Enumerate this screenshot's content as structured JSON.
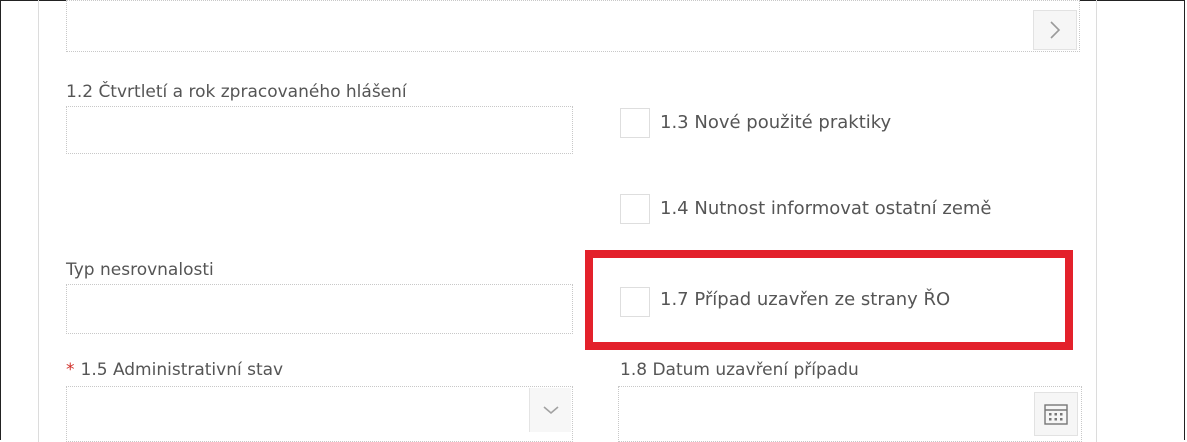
{
  "form": {
    "field_1_2": {
      "label": "1.2 Čtvrtletí a rok zpracovaného hlášení"
    },
    "checkbox_1_3": {
      "label": "1.3 Nové použité praktiky"
    },
    "checkbox_1_4": {
      "label": "1.4 Nutnost informovat ostatní země"
    },
    "typ_nesrovnalosti": {
      "label": "Typ nesrovnalosti"
    },
    "checkbox_1_7": {
      "label": "1.7 Případ uzavřen ze strany ŘO"
    },
    "field_1_5": {
      "required_marker": "*",
      "label": "1.5 Administrativní stav"
    },
    "field_1_8": {
      "label": "1.8 Datum uzavření případu"
    }
  },
  "icons": {
    "top_right": "chevron-right-icon",
    "dropdown": "chevron-down-icon",
    "date": "calendar-icon"
  },
  "colors": {
    "highlight": "#e3212b",
    "required": "#d0302a"
  }
}
